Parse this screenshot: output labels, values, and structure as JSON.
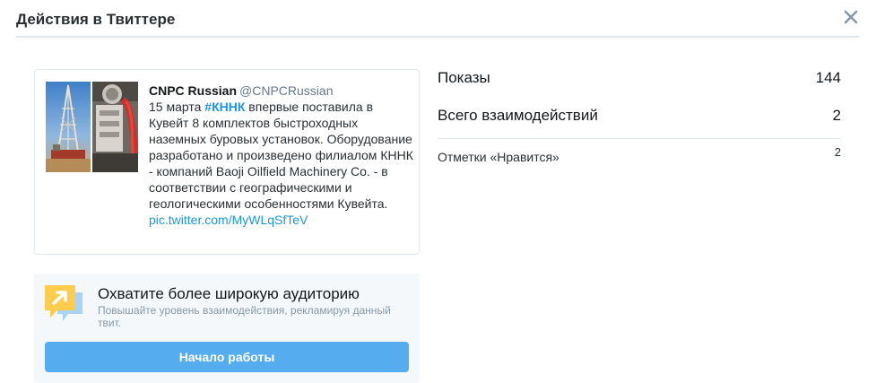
{
  "dialog": {
    "title": "Действия в Твиттере",
    "close_icon": "close-icon"
  },
  "tweet": {
    "author_name": "CNPC Russian",
    "author_handle": "@CNPCRussian",
    "text_before": "15 марта ",
    "hashtag": "#КННК",
    "text_after": " впервые поставила в Кувейт 8 комплектов быстроходных наземных буровых установок. Оборудование разработано и произведено филиалом КННК - компаний Baoji Oilfield Machinery Co. - в соответствии с географическими и геологическими особенностями Кувейта.",
    "link": "pic.twitter.com/MyWLqSfTeV",
    "media_icons": [
      "drilling-rig-photo",
      "industrial-equipment-photo"
    ]
  },
  "promo": {
    "icon": "promote-arrow-icon",
    "title": "Охватите более широкую аудиторию",
    "description": "Повышайте уровень взаимодействия, рекламируя данный твит.",
    "button_label": "Начало работы"
  },
  "metrics": {
    "impressions_label": "Показы",
    "impressions_value": "144",
    "engagements_label": "Всего взаимодействий",
    "engagements_value": "2",
    "likes_label": "Отметки «Нравится»",
    "likes_value": "2"
  },
  "colors": {
    "accent": "#1b95e0",
    "button": "#55acee",
    "promo_bg": "#f5f8fa",
    "border": "#e1e8ed",
    "muted": "#8899a6"
  }
}
